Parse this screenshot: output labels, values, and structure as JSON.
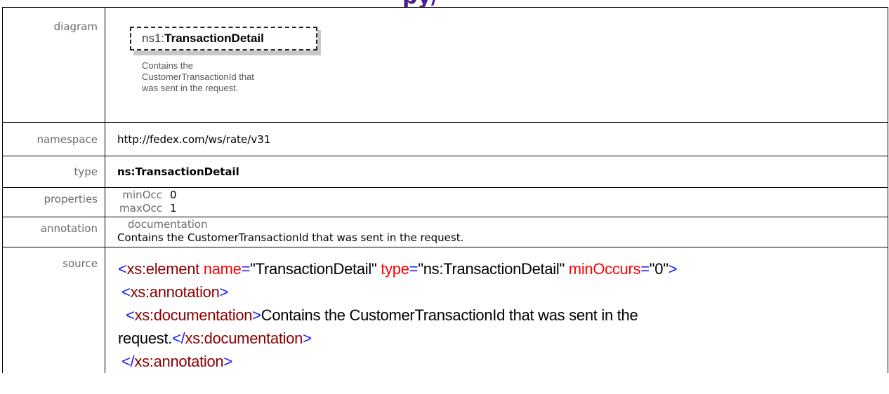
{
  "banner": {
    "text": "py/"
  },
  "rows": {
    "diagram": {
      "label": "diagram",
      "node_prefix": "ns1:",
      "node_name": "TransactionDetail",
      "doc_lines": [
        "Contains the",
        "CustomerTransactionId that",
        "was sent in the request."
      ]
    },
    "namespace": {
      "label": "namespace",
      "value": "http://fedex.com/ws/rate/v31"
    },
    "type": {
      "label": "type",
      "value": "ns:TransactionDetail"
    },
    "properties": {
      "label": "properties",
      "items": [
        {
          "key": "minOcc",
          "value": "0"
        },
        {
          "key": "maxOcc",
          "value": "1"
        }
      ]
    },
    "annotation": {
      "label": "annotation",
      "heading": "documentation",
      "text": "Contains the CustomerTransactionId that was sent in the request."
    },
    "source": {
      "label": "source",
      "l1_open": "<xs:element",
      "l1_attr1": " name=",
      "l1_val1": "\"TransactionDetail\"",
      "l1_attr2": " type=",
      "l1_val2": "\"ns:TransactionDetail\"",
      "l1_attr3": " minOccurs=",
      "l1_val3": "\"0\"",
      "l1_close": ">",
      "l2": "<xs:annotation>",
      "l3_open": "<xs:documentation>",
      "l3_text": "Contains the CustomerTransactionId that was sent in the",
      "l4_text": "request.",
      "l4_close": "</xs:documentation>",
      "l5": "</xs:annotation>"
    }
  },
  "colors": {
    "banner": "#4b1f8f",
    "label_gray": "#6b6b6b",
    "xml_tag": "#8b0000",
    "xml_bracket": "#1a1aff",
    "xml_attr": "#ff0000"
  }
}
